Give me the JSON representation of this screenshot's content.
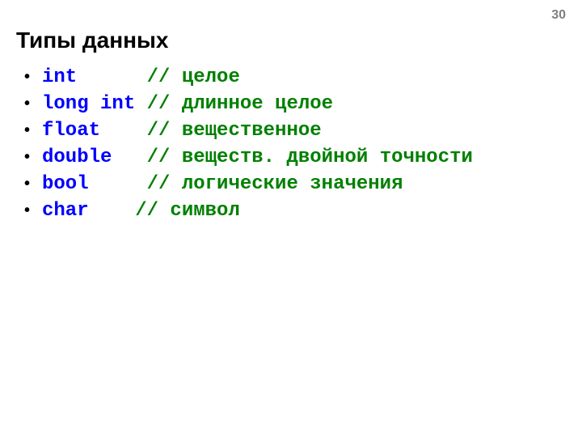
{
  "page_number": "30",
  "title": "Типы данных",
  "items": [
    {
      "type": "int",
      "pad": "      ",
      "comment": "// целое"
    },
    {
      "type": "long int",
      "pad": " ",
      "comment": "// длинное целое"
    },
    {
      "type": "float",
      "pad": "    ",
      "comment": "// вещественное"
    },
    {
      "type": "double",
      "pad": "   ",
      "comment": "// веществ. двойной точности"
    },
    {
      "type": "bool",
      "pad": "     ",
      "comment": "// логические значения"
    },
    {
      "type": "char",
      "pad": "    ",
      "comment": "// символ"
    }
  ]
}
